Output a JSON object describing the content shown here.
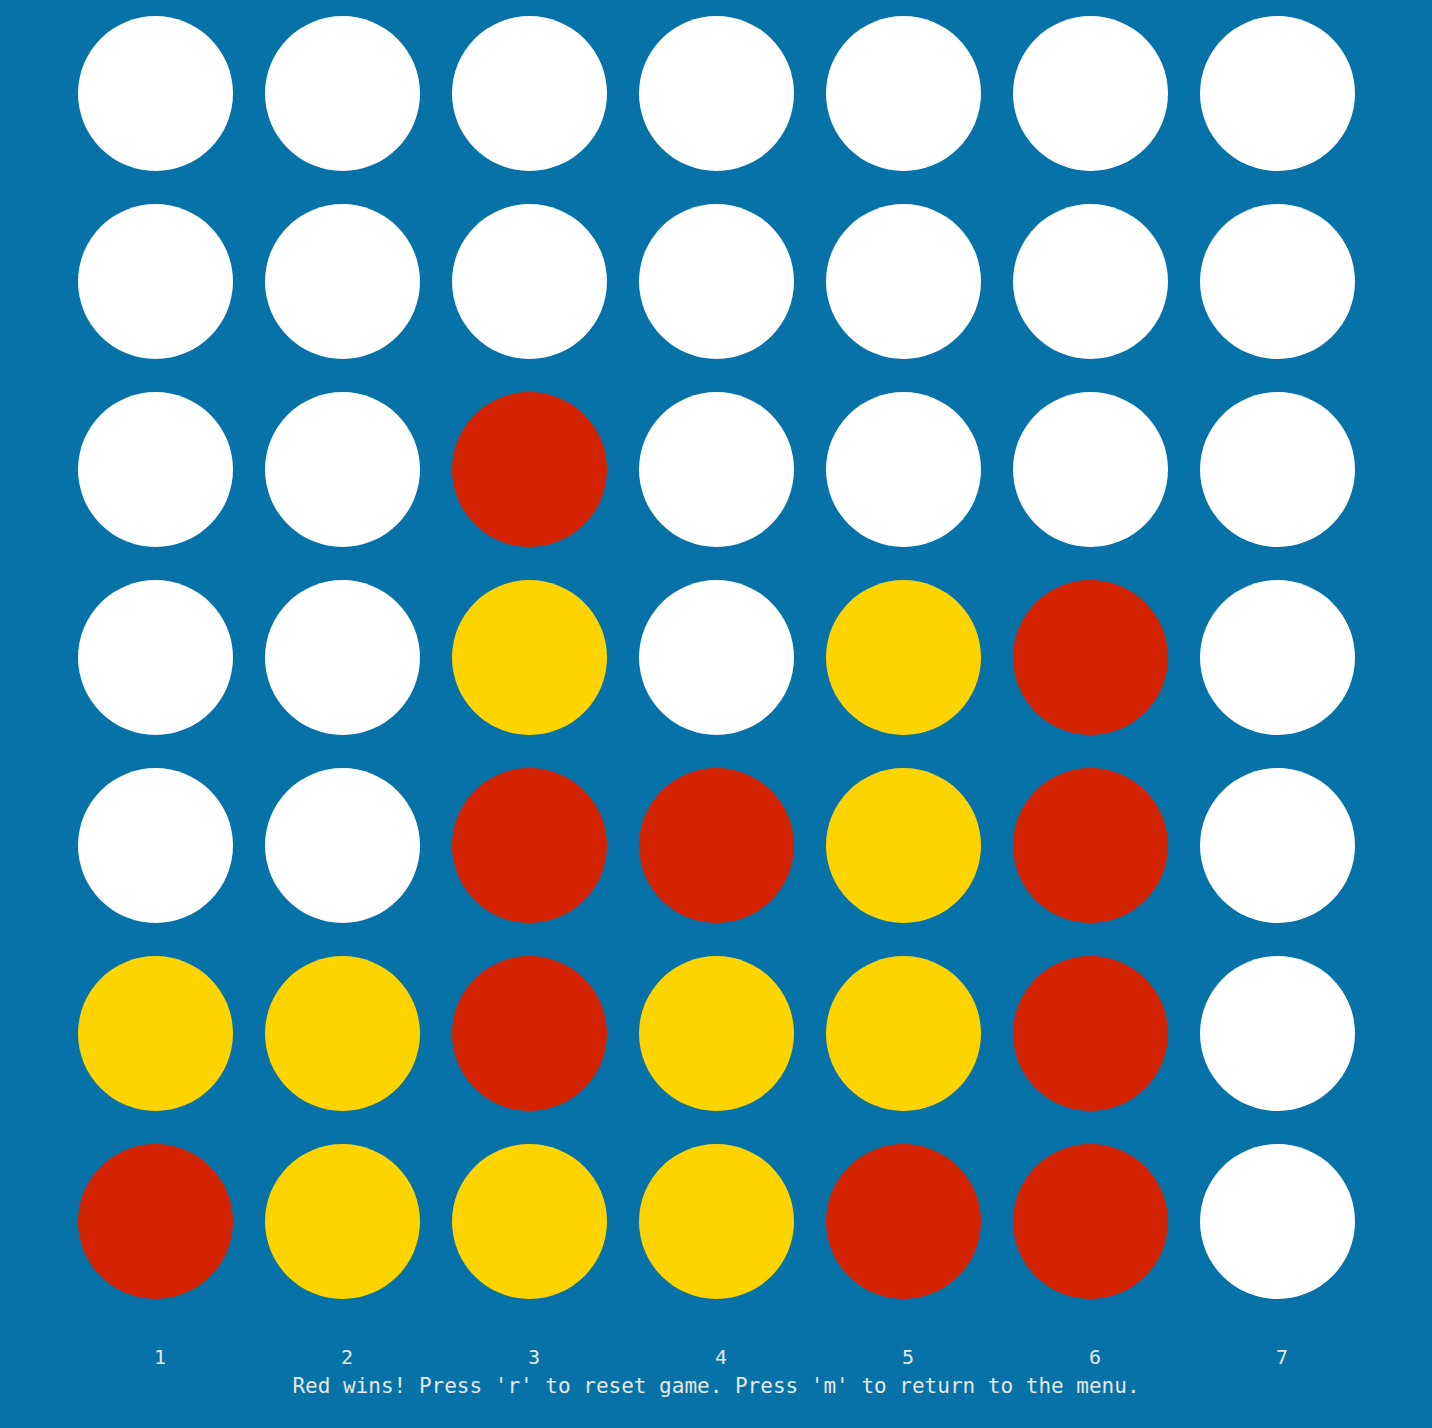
{
  "board": {
    "rows": [
      {
        "cells": [
          {
            "piece": "empty",
            "color": "#ffffff"
          },
          {
            "piece": "empty",
            "color": "#ffffff"
          },
          {
            "piece": "empty",
            "color": "#ffffff"
          },
          {
            "piece": "empty",
            "color": "#ffffff"
          },
          {
            "piece": "empty",
            "color": "#ffffff"
          },
          {
            "piece": "empty",
            "color": "#ffffff"
          },
          {
            "piece": "empty",
            "color": "#ffffff"
          }
        ]
      },
      {
        "cells": [
          {
            "piece": "empty",
            "color": "#ffffff"
          },
          {
            "piece": "empty",
            "color": "#ffffff"
          },
          {
            "piece": "empty",
            "color": "#ffffff"
          },
          {
            "piece": "empty",
            "color": "#ffffff"
          },
          {
            "piece": "empty",
            "color": "#ffffff"
          },
          {
            "piece": "empty",
            "color": "#ffffff"
          },
          {
            "piece": "empty",
            "color": "#ffffff"
          }
        ]
      },
      {
        "cells": [
          {
            "piece": "empty",
            "color": "#ffffff"
          },
          {
            "piece": "empty",
            "color": "#ffffff"
          },
          {
            "piece": "red",
            "color": "#d42300"
          },
          {
            "piece": "empty",
            "color": "#ffffff"
          },
          {
            "piece": "empty",
            "color": "#ffffff"
          },
          {
            "piece": "empty",
            "color": "#ffffff"
          },
          {
            "piece": "empty",
            "color": "#ffffff"
          }
        ]
      },
      {
        "cells": [
          {
            "piece": "empty",
            "color": "#ffffff"
          },
          {
            "piece": "empty",
            "color": "#ffffff"
          },
          {
            "piece": "yellow",
            "color": "#fdd400"
          },
          {
            "piece": "empty",
            "color": "#ffffff"
          },
          {
            "piece": "yellow",
            "color": "#fdd400"
          },
          {
            "piece": "red",
            "color": "#d42300"
          },
          {
            "piece": "empty",
            "color": "#ffffff"
          }
        ]
      },
      {
        "cells": [
          {
            "piece": "empty",
            "color": "#ffffff"
          },
          {
            "piece": "empty",
            "color": "#ffffff"
          },
          {
            "piece": "red",
            "color": "#d42300"
          },
          {
            "piece": "red",
            "color": "#d42300"
          },
          {
            "piece": "yellow",
            "color": "#fdd400"
          },
          {
            "piece": "red",
            "color": "#d42300"
          },
          {
            "piece": "empty",
            "color": "#ffffff"
          }
        ]
      },
      {
        "cells": [
          {
            "piece": "yellow",
            "color": "#fdd400"
          },
          {
            "piece": "yellow",
            "color": "#fdd400"
          },
          {
            "piece": "red",
            "color": "#d42300"
          },
          {
            "piece": "yellow",
            "color": "#fdd400"
          },
          {
            "piece": "yellow",
            "color": "#fdd400"
          },
          {
            "piece": "red",
            "color": "#d42300"
          },
          {
            "piece": "empty",
            "color": "#ffffff"
          }
        ]
      },
      {
        "cells": [
          {
            "piece": "red",
            "color": "#d42300"
          },
          {
            "piece": "yellow",
            "color": "#fdd400"
          },
          {
            "piece": "yellow",
            "color": "#fdd400"
          },
          {
            "piece": "yellow",
            "color": "#fdd400"
          },
          {
            "piece": "red",
            "color": "#d42300"
          },
          {
            "piece": "red",
            "color": "#d42300"
          },
          {
            "piece": "empty",
            "color": "#ffffff"
          }
        ]
      }
    ]
  },
  "column_labels": [
    "1",
    "2",
    "3",
    "4",
    "5",
    "6",
    "7"
  ],
  "status_bar": {
    "message": "Red wins! Press 'r' to reset game. Press 'm' to return to the menu."
  }
}
